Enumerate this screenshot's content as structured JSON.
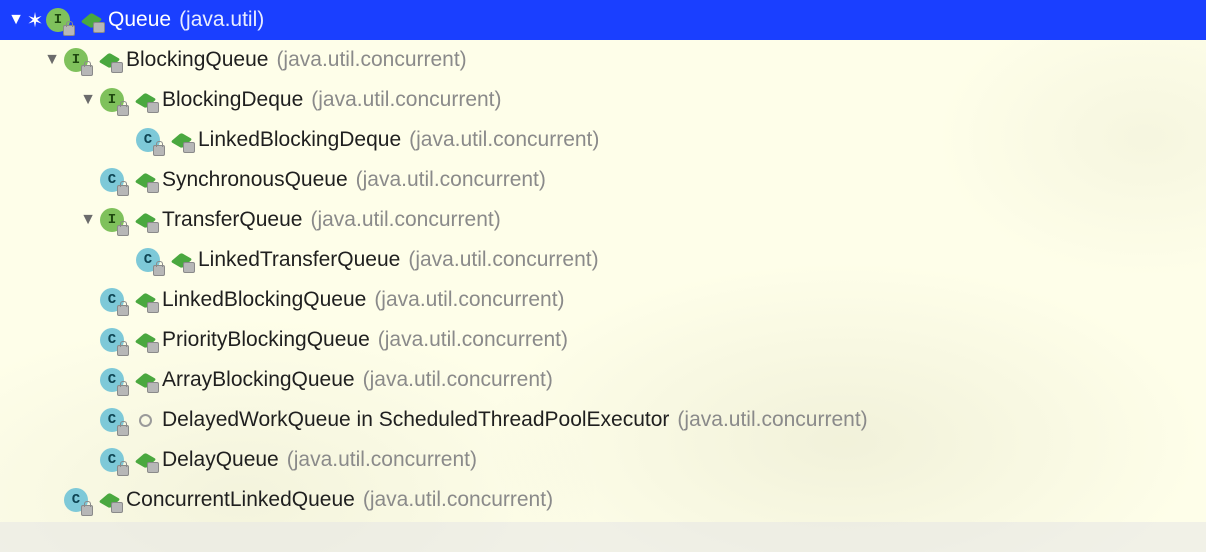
{
  "tree": [
    {
      "depth": 0,
      "arrow": "down",
      "asterisk": true,
      "kind": "I",
      "visibility": "public",
      "name": "Queue",
      "pkg": "(java.util)",
      "selected": true
    },
    {
      "depth": 1,
      "arrow": "down",
      "asterisk": false,
      "kind": "I",
      "visibility": "public",
      "name": "BlockingQueue",
      "pkg": "(java.util.concurrent)",
      "selected": false
    },
    {
      "depth": 2,
      "arrow": "down",
      "asterisk": false,
      "kind": "I",
      "visibility": "public",
      "name": "BlockingDeque",
      "pkg": "(java.util.concurrent)",
      "selected": false
    },
    {
      "depth": 3,
      "arrow": "none",
      "asterisk": false,
      "kind": "C",
      "visibility": "public",
      "name": "LinkedBlockingDeque",
      "pkg": "(java.util.concurrent)",
      "selected": false
    },
    {
      "depth": 2,
      "arrow": "none",
      "asterisk": false,
      "kind": "C",
      "visibility": "public",
      "name": "SynchronousQueue",
      "pkg": "(java.util.concurrent)",
      "selected": false
    },
    {
      "depth": 2,
      "arrow": "down",
      "asterisk": false,
      "kind": "I",
      "visibility": "public",
      "name": "TransferQueue",
      "pkg": "(java.util.concurrent)",
      "selected": false
    },
    {
      "depth": 3,
      "arrow": "none",
      "asterisk": false,
      "kind": "C",
      "visibility": "public",
      "name": "LinkedTransferQueue",
      "pkg": "(java.util.concurrent)",
      "selected": false
    },
    {
      "depth": 2,
      "arrow": "none",
      "asterisk": false,
      "kind": "C",
      "visibility": "public",
      "name": "LinkedBlockingQueue",
      "pkg": "(java.util.concurrent)",
      "selected": false
    },
    {
      "depth": 2,
      "arrow": "none",
      "asterisk": false,
      "kind": "C",
      "visibility": "public",
      "name": "PriorityBlockingQueue",
      "pkg": "(java.util.concurrent)",
      "selected": false
    },
    {
      "depth": 2,
      "arrow": "none",
      "asterisk": false,
      "kind": "C",
      "visibility": "public",
      "name": "ArrayBlockingQueue",
      "pkg": "(java.util.concurrent)",
      "selected": false
    },
    {
      "depth": 2,
      "arrow": "none",
      "asterisk": false,
      "kind": "C",
      "visibility": "package",
      "name": "DelayedWorkQueue in ScheduledThreadPoolExecutor",
      "pkg": "(java.util.concurrent)",
      "selected": false
    },
    {
      "depth": 2,
      "arrow": "none",
      "asterisk": false,
      "kind": "C",
      "visibility": "public",
      "name": "DelayQueue",
      "pkg": "(java.util.concurrent)",
      "selected": false
    },
    {
      "depth": 1,
      "arrow": "none",
      "asterisk": false,
      "kind": "C",
      "visibility": "public",
      "name": "ConcurrentLinkedQueue",
      "pkg": "(java.util.concurrent)",
      "selected": false
    }
  ],
  "glyphs": {
    "arrow_down": "▼",
    "arrow_right": "▶",
    "asterisk": "✶"
  }
}
